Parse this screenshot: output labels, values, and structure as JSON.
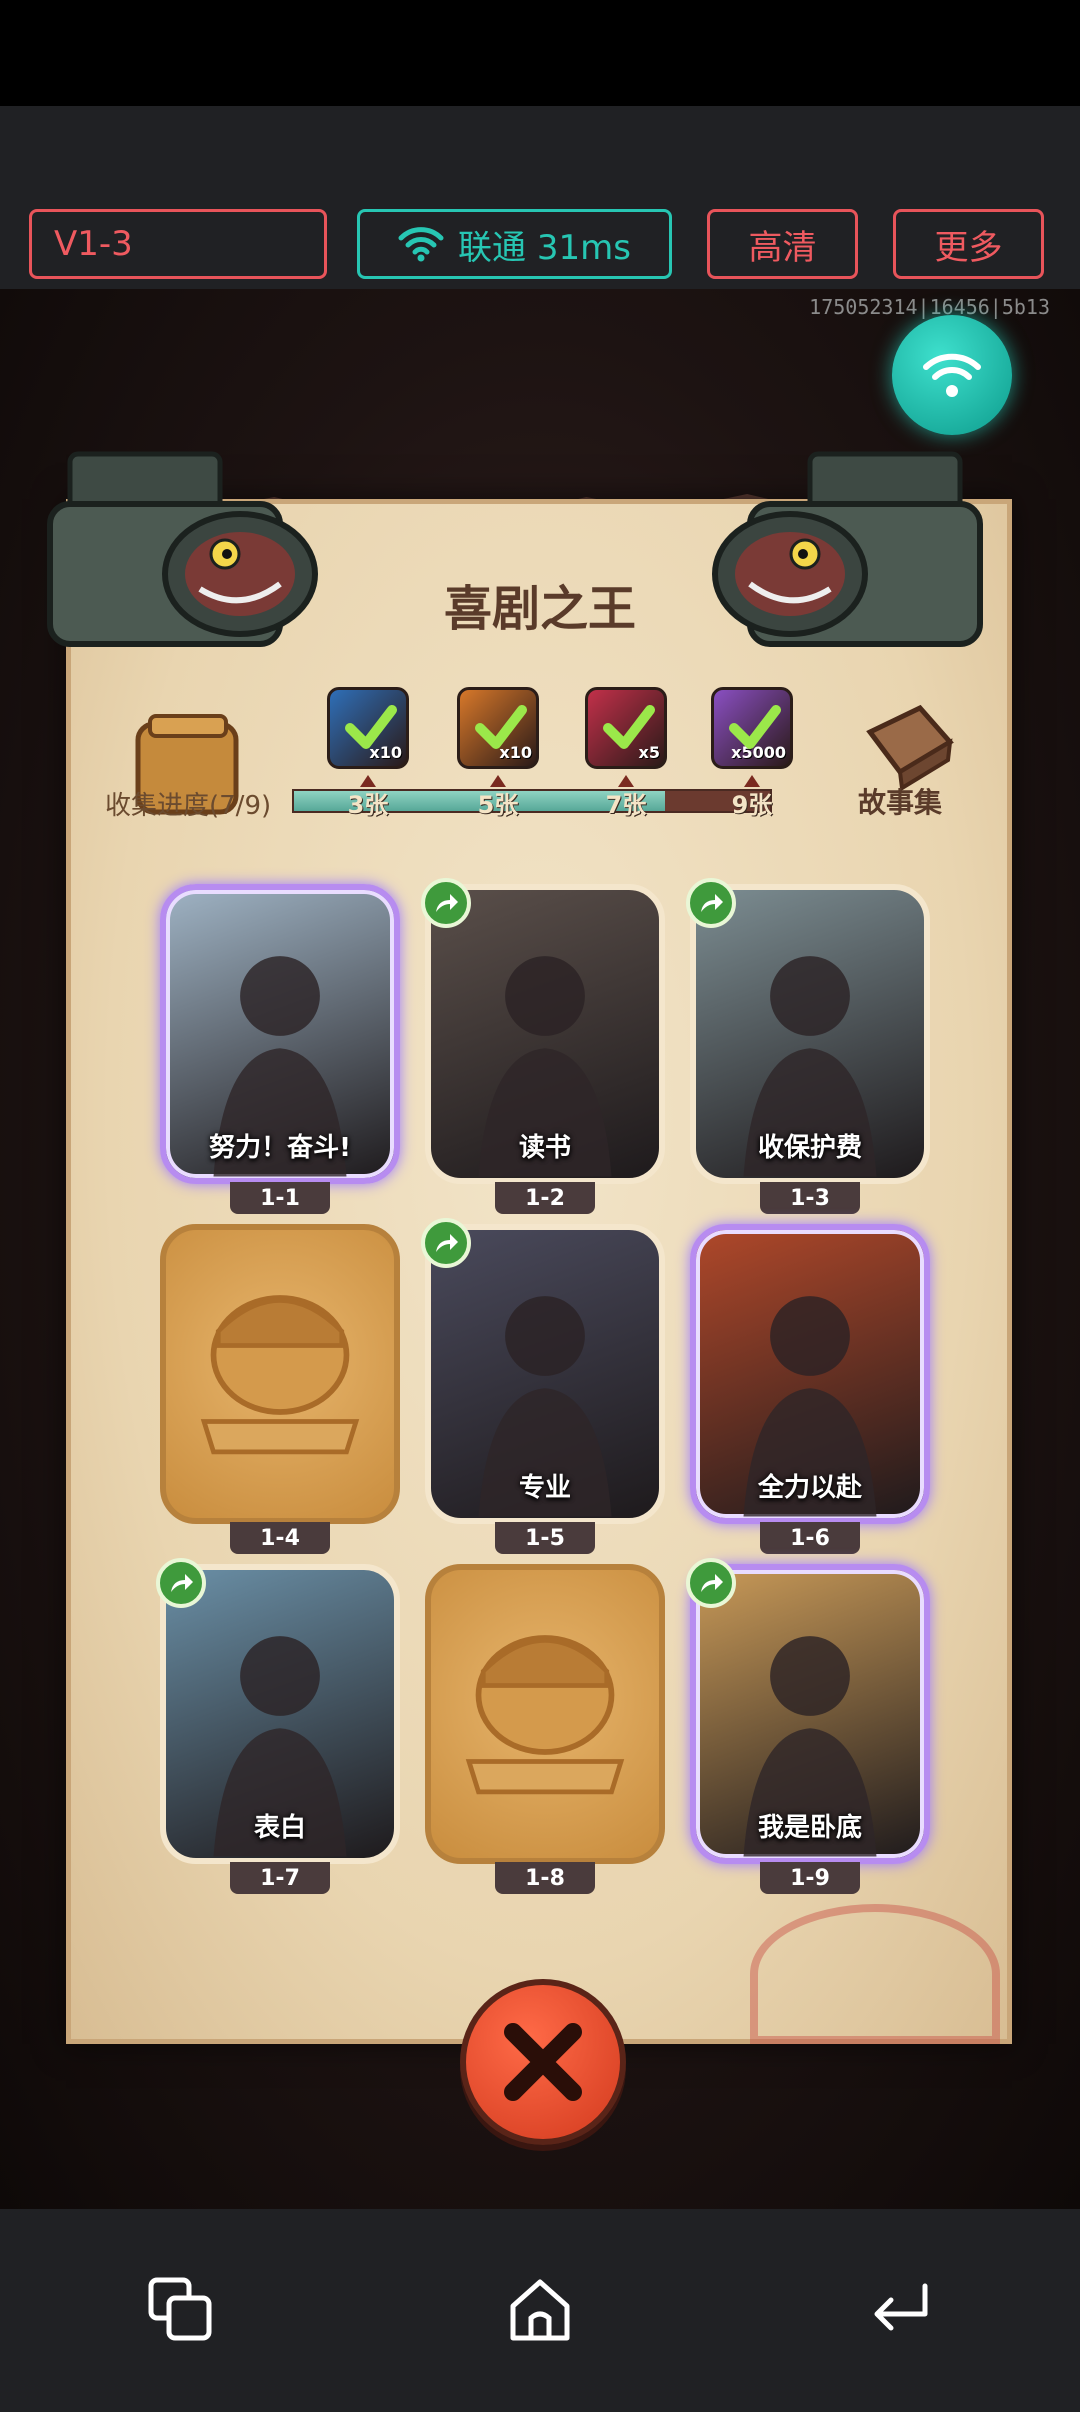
{
  "toolbar": {
    "version": "V1-3",
    "network": "联通 31ms",
    "quality": "高清",
    "more": "更多"
  },
  "session_id": "175052314|16456|5b13",
  "game": {
    "title": "喜剧之王",
    "collection_label": "收集进度(7/9)",
    "collection_progress": 0.78,
    "story_label": "故事集",
    "milestones": [
      {
        "label": "3张",
        "reward": "x10",
        "color": "#2f6fb8"
      },
      {
        "label": "5张",
        "reward": "x10",
        "color": "#d7782a"
      },
      {
        "label": "7张",
        "reward": "x5",
        "color": "#c2304a"
      },
      {
        "label": "9张",
        "reward": "x5000",
        "color": "#8a4fc2"
      }
    ],
    "cards": [
      {
        "level": "1-1",
        "caption": "努力！奋斗!",
        "state": "purple",
        "share": false,
        "art": "#9fb3c4"
      },
      {
        "level": "1-2",
        "caption": "读书",
        "state": "normal",
        "share": true,
        "art": "#5a4f4a"
      },
      {
        "level": "1-3",
        "caption": "收保护费",
        "state": "normal",
        "share": true,
        "art": "#7c8d92"
      },
      {
        "level": "1-4",
        "caption": "",
        "state": "locked",
        "share": false,
        "art": ""
      },
      {
        "level": "1-5",
        "caption": "专业",
        "state": "normal",
        "share": true,
        "art": "#4a4a5c"
      },
      {
        "level": "1-6",
        "caption": "全力以赴",
        "state": "purple",
        "share": false,
        "art": "#b0482a"
      },
      {
        "level": "1-7",
        "caption": "表白",
        "state": "normal",
        "share": true,
        "art": "#6a8fa6"
      },
      {
        "level": "1-8",
        "caption": "",
        "state": "locked",
        "share": false,
        "art": ""
      },
      {
        "level": "1-9",
        "caption": "我是卧底",
        "state": "purple",
        "share": true,
        "art": "#c99a58"
      }
    ]
  },
  "colors": {
    "toolbar_red": "#e8545a",
    "toolbar_teal": "#27c6b3",
    "close_red": "#d23a1e"
  }
}
